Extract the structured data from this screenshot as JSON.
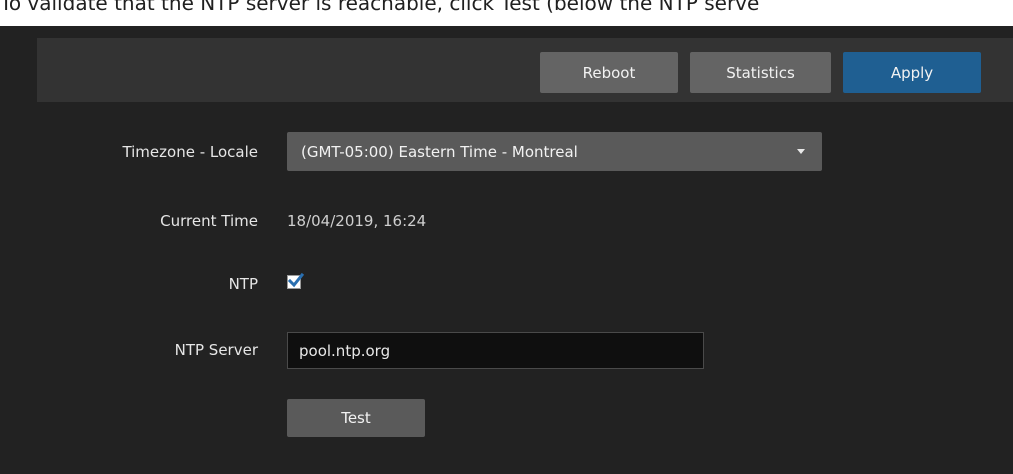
{
  "top_text": "To validate that the NTP server is reachable, click Test (below the NTP serve",
  "toolbar": {
    "reboot_label": "Reboot",
    "statistics_label": "Statistics",
    "apply_label": "Apply"
  },
  "form": {
    "timezone_label": "Timezone - Locale",
    "timezone_value": "(GMT-05:00) Eastern Time - Montreal",
    "current_time_label": "Current Time",
    "current_time_value": "18/04/2019, 16:24",
    "ntp_label": "NTP",
    "ntp_checked": true,
    "ntp_server_label": "NTP Server",
    "ntp_server_value": "pool.ntp.org",
    "test_label": "Test"
  },
  "colors": {
    "background": "#222222",
    "toolbar": "#333333",
    "button": "#646464",
    "apply_button": "#1f5f92",
    "checkbox_check": "#2a6fb0"
  },
  "icons": {
    "select_caret": "chevron-down-icon",
    "checkbox_mark": "checkmark-icon"
  }
}
